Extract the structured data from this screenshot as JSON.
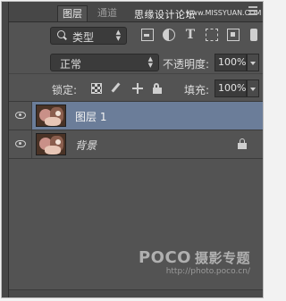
{
  "tabs": [
    {
      "label": "图层",
      "active": true
    },
    {
      "label": "通道",
      "active": false
    }
  ],
  "watermark_top": {
    "text": "思缘设计论坛",
    "url": "www.MISSYUAN.COM"
  },
  "filter": {
    "label": "类型",
    "icons": [
      "pixel-filter-icon",
      "adjustment-filter-icon",
      "type-filter-icon",
      "shape-filter-icon",
      "smart-object-filter-icon",
      "filter-toggle-icon"
    ]
  },
  "blend": {
    "mode": "正常",
    "opacity_label": "不透明度:",
    "opacity_value": "100%"
  },
  "lock": {
    "label": "锁定:",
    "icons": [
      "lock-transparent-pixels-icon",
      "lock-image-pixels-icon",
      "lock-position-icon",
      "lock-all-icon"
    ],
    "fill_label": "填充:",
    "fill_value": "100%"
  },
  "layers": [
    {
      "name": "图层 1",
      "selected": true,
      "visible": true,
      "locked": false
    },
    {
      "name": "背景",
      "selected": false,
      "visible": true,
      "locked": true
    }
  ],
  "footer_watermark": {
    "brand": "POCO",
    "brand_cn": "摄影专题",
    "url": "http://photo.poco.cn/"
  },
  "colors": {
    "panel_bg": "#535353",
    "selection": "#6b7d99",
    "text": "#dcdcdc"
  }
}
